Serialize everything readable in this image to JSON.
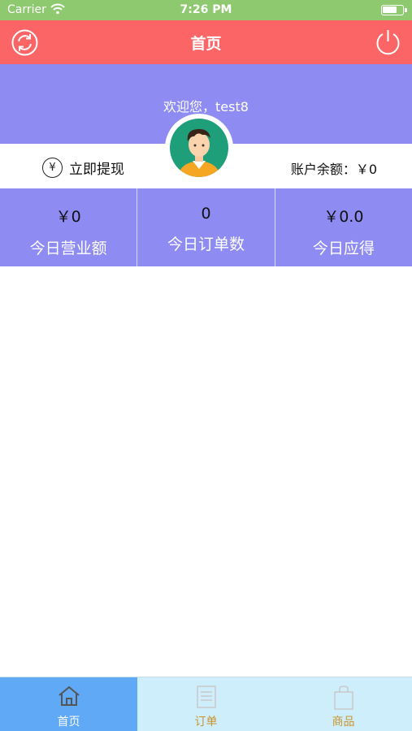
{
  "status_bar": {
    "carrier": "Carrier",
    "time": "7:26 PM"
  },
  "nav": {
    "title": "首页",
    "left_icon": "refresh-icon",
    "right_icon": "power-icon"
  },
  "banner": {
    "welcome": "欢迎您，test8"
  },
  "balance_strip": {
    "withdraw_icon": "yen-circle-icon",
    "withdraw_label": "立即提现",
    "balance_text": "账户余额：￥0"
  },
  "stats": [
    {
      "value": "￥0",
      "caption": "今日营业额"
    },
    {
      "value": "0",
      "caption": "今日订单数"
    },
    {
      "value": "￥0.0",
      "caption": "今日应得"
    }
  ],
  "tabs": [
    {
      "label": "首页",
      "icon": "home-icon",
      "active": true
    },
    {
      "label": "订单",
      "icon": "order-list-icon",
      "active": false
    },
    {
      "label": "商品",
      "icon": "shopping-bag-icon",
      "active": false
    }
  ],
  "colors": {
    "status_bar": "#8fc96f",
    "nav_bar": "#fb6565",
    "banner": "#8e8bf2",
    "tab_active": "#5fa9f7",
    "tab_inactive": "#cfeefc",
    "tab_inactive_text": "#c8942f"
  }
}
